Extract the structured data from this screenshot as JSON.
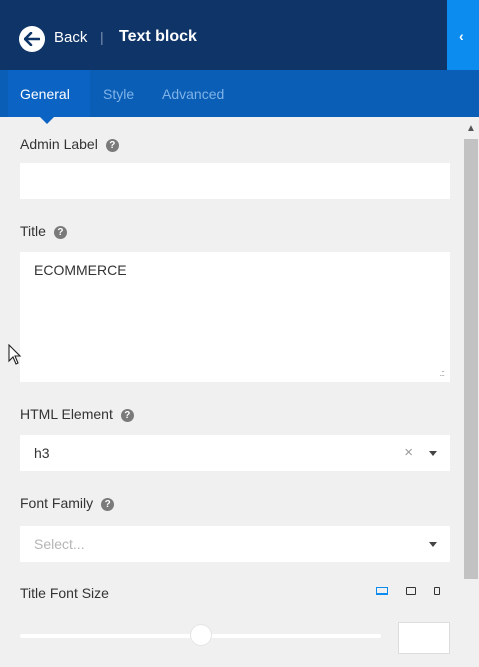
{
  "header": {
    "back_label": "Back",
    "separator": "|",
    "title": "Text block",
    "collapse_glyph": "‹"
  },
  "tabs": [
    {
      "label": "General",
      "active": true
    },
    {
      "label": "Style",
      "active": false
    },
    {
      "label": "Advanced",
      "active": false
    }
  ],
  "fields": {
    "admin_label": {
      "label": "Admin Label",
      "value": ""
    },
    "title": {
      "label": "Title",
      "value": "ECOMMERCE"
    },
    "html_element": {
      "label": "HTML Element",
      "value": "h3",
      "clear": "×"
    },
    "font_family": {
      "label": "Font Family",
      "placeholder": "Select..."
    },
    "title_font_size": {
      "label": "Title Font Size",
      "value": "",
      "slider_fraction": 0.5
    }
  },
  "help_glyph": "?",
  "responsive_devices": [
    {
      "name": "desktop",
      "active": true
    },
    {
      "name": "tablet",
      "active": false
    },
    {
      "name": "mobile",
      "active": false
    }
  ],
  "colors": {
    "header_bg": "#0e3468",
    "tabs_bg": "#0a5eb5",
    "accent": "#0d8cf0",
    "panel_bg": "#f0f0f0"
  }
}
